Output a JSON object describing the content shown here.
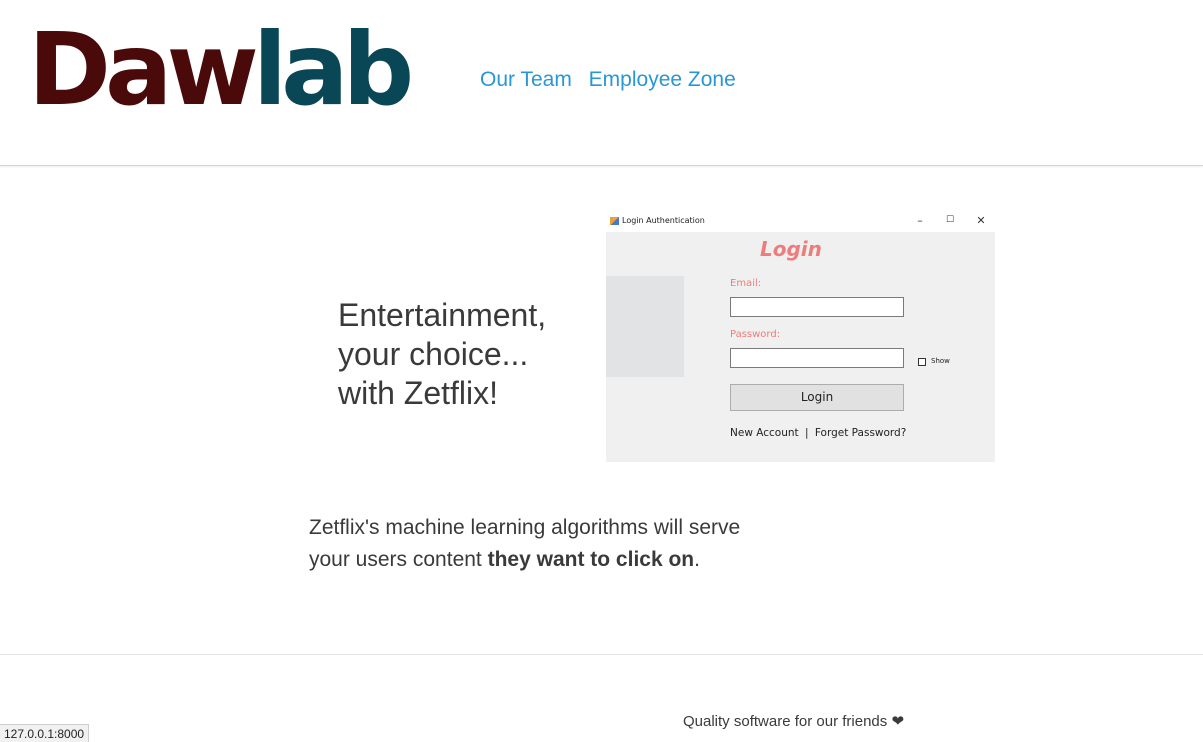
{
  "header": {
    "logo_part1": "Daw",
    "logo_part2": "lab",
    "nav": [
      "Our Team",
      "Employee Zone"
    ]
  },
  "hero": {
    "tagline": [
      "Entertainment,",
      "your choice...",
      "with Zetflix!"
    ]
  },
  "login_window": {
    "title": "Login Authentication",
    "controls": [
      "–",
      "☐",
      "✕"
    ],
    "heading": "Login",
    "email_label": "Email:",
    "email_value": "",
    "password_label": "Password:",
    "password_value": "",
    "show_label": "Show",
    "button_label": "Login",
    "link_new": "New Account",
    "link_separator": "|",
    "link_forgot": "Forget Password?"
  },
  "description": {
    "line1": "Zetflix's machine learning algorithms will serve",
    "line2_start": "your users content ",
    "line2_bold": "they want to click on",
    "line2_end": "."
  },
  "footer": {
    "text": "Quality software for our friends",
    "heart": "❤"
  },
  "status_bar": {
    "url": "127.0.0.1:8000"
  },
  "colors": {
    "logo_daw": "#4a0a0a",
    "logo_lab": "#0a4756",
    "nav_link": "#2a96d6",
    "login_accent": "#ee7c7c"
  }
}
